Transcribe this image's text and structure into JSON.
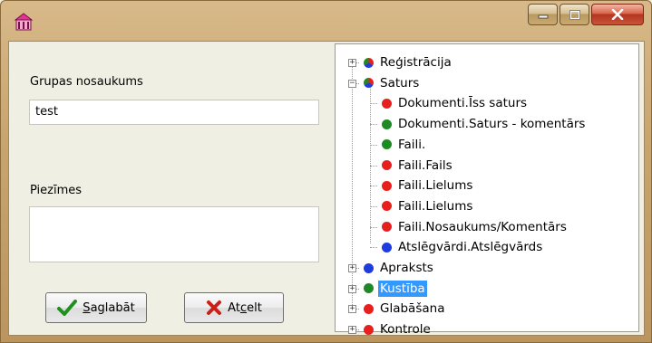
{
  "window": {
    "app_icon": "building-icon",
    "controls": {
      "minimize": "minimize-icon",
      "maximize": "maximize-icon",
      "close": "close-icon"
    }
  },
  "form": {
    "group_name_label": "Grupas nosaukums",
    "group_name_value": "test",
    "notes_label": "Piezīmes",
    "notes_value": "",
    "save_underlined": "S",
    "save_rest": "aglabāt",
    "cancel_prefix": "At",
    "cancel_underlined": "c",
    "cancel_rest": "elt"
  },
  "tree": {
    "colors": {
      "red": "#e8201d",
      "green": "#1f8a25",
      "blue": "#1c3ce0"
    },
    "nodes": [
      {
        "label": "Reģistrācija",
        "color": "multi",
        "expander": "+"
      },
      {
        "label": "Saturs",
        "color": "multi",
        "expander": "-"
      },
      {
        "label": "Dokumenti.Īss saturs",
        "color": "red"
      },
      {
        "label": "Dokumenti.Saturs - komentārs",
        "color": "green"
      },
      {
        "label": "Faili.",
        "color": "green"
      },
      {
        "label": "Faili.Fails",
        "color": "red"
      },
      {
        "label": "Faili.Lielums",
        "color": "red"
      },
      {
        "label": "Faili.Lielums",
        "color": "red"
      },
      {
        "label": "Faili.Nosaukums/Komentārs",
        "color": "red"
      },
      {
        "label": "Atslēgvārdi.Atslēgvārds",
        "color": "blue"
      },
      {
        "label": "Apraksts",
        "color": "blue",
        "expander": "+"
      },
      {
        "label": "Kustība",
        "color": "green",
        "expander": "+",
        "selected": true
      },
      {
        "label": "Glabāšana",
        "color": "red",
        "expander": "+"
      },
      {
        "label": "Kontrole",
        "color": "red",
        "expander": "+"
      }
    ]
  }
}
